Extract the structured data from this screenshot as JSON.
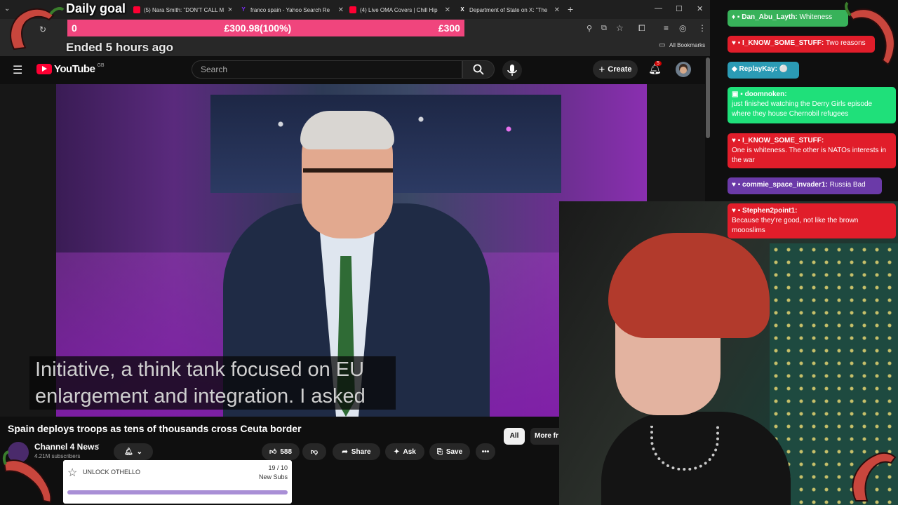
{
  "browser": {
    "tabs": [
      {
        "label": "(5) Nara Smith: \"DON'T CALL M",
        "icon": "youtube-icon",
        "color": "#ff0033"
      },
      {
        "label": "franco spain - Yahoo Search Re",
        "icon": "yahoo-icon",
        "color": "#7b2ff7"
      },
      {
        "label": "(4) Live OMA Covers | Chill Hip",
        "icon": "youtube-icon",
        "color": "#ff0033"
      },
      {
        "label": "Department of State on X: \"The",
        "icon": "x-icon",
        "color": "#ffffff"
      }
    ],
    "bookmarks_label": "All Bookmarks",
    "new_tab": "+"
  },
  "goal": {
    "title": "Daily goal",
    "start": "0",
    "current": "£300.98(100%)",
    "target": "£300",
    "progress": 100,
    "status": "Ended 5 hours ago",
    "color": "#f0457d"
  },
  "youtube": {
    "logo_text": "YouTube",
    "region": "GB",
    "search_placeholder": "Search",
    "create_label": "Create",
    "notif_count": "5"
  },
  "video": {
    "subtitle_line1": "Initiative, a think tank focused on EU",
    "subtitle_line2": "enlargement and integration. I asked",
    "title": "Spain deploys troops as tens of thousands cross Ceuta border",
    "channel": "Channel 4 News",
    "subscribers": "4.21M subscribers",
    "likes": "588",
    "share_label": "Share",
    "ask_label": "Ask",
    "save_label": "Save",
    "chip_all": "All",
    "chip_more": "More fr"
  },
  "othello": {
    "label": "UNLOCK OTHELLO",
    "count": "19 / 10",
    "sub_label": "New Subs",
    "progress": 1.0,
    "accent": "#a98fd6"
  },
  "chat": [
    {
      "user": "Dan_Abu_Layth",
      "sep": ":",
      "msg": "Whiteness",
      "color": "#38b25a"
    },
    {
      "user": "I_KNOW_SOME_STUFF",
      "sep": ":",
      "msg": "Two reasons",
      "color": "#e11d2a"
    },
    {
      "user": "ReplayKay",
      "sep": ":",
      "msg": "⚪",
      "color": "#2b9bb5"
    },
    {
      "user": "doomnoken",
      "sep": ":",
      "msg": "just finished watching the Derry Girls episode where they house Chernobil refugees",
      "color": "#1fe07a"
    },
    {
      "user": "I_KNOW_SOME_STUFF",
      "sep": ":",
      "msg": "One is whiteness. The other is NATOs interests in the war",
      "color": "#e11d2a"
    },
    {
      "user": "commie_space_invader1",
      "sep": ":",
      "msg": "Russia Bad",
      "color": "#6b3aa8"
    },
    {
      "user": "Stephen2point1",
      "sep": ":",
      "msg": "Because they're good, not like the brown moooslims",
      "color": "#e11d2a"
    }
  ]
}
